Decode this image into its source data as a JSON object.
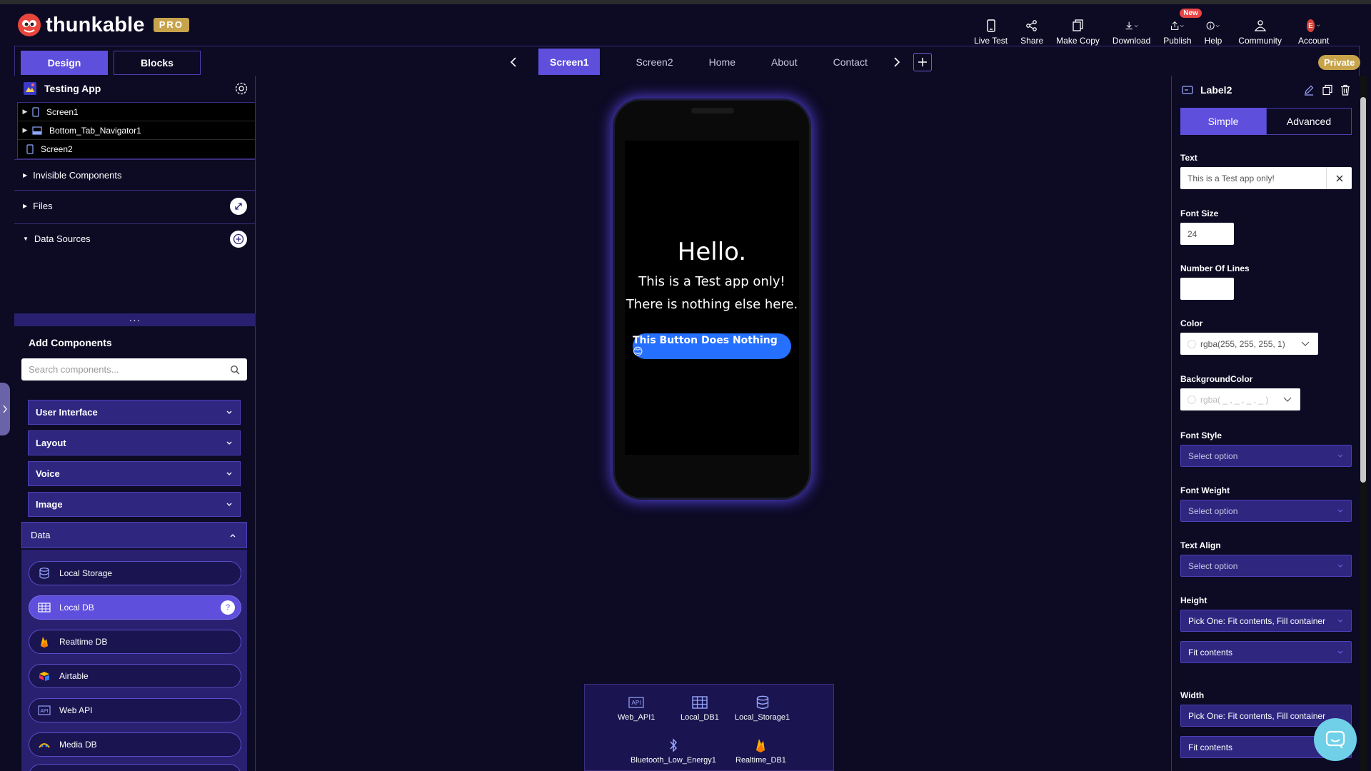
{
  "brand": {
    "name": "thunkable",
    "badge": "PRO"
  },
  "topnav": [
    {
      "label": "Live Test",
      "icon": "phone-icon"
    },
    {
      "label": "Share",
      "icon": "share-icon"
    },
    {
      "label": "Make Copy",
      "icon": "copy-icon"
    },
    {
      "label": "Download",
      "icon": "download-icon"
    },
    {
      "label": "Publish",
      "icon": "publish-icon",
      "badge": "New"
    },
    {
      "label": "Help",
      "icon": "info-icon"
    },
    {
      "label": "Community",
      "icon": "community-icon"
    },
    {
      "label": "Account",
      "icon": "avatar",
      "avatar_letter": "E"
    }
  ],
  "editor_tabs": {
    "design": "Design",
    "blocks": "Blocks"
  },
  "screen_tabs": [
    "Screen1",
    "Screen2",
    "Home",
    "About",
    "Contact"
  ],
  "active_screen": "Screen1",
  "visibility_badge": "Private",
  "left_panel": {
    "app_name": "Testing App",
    "tree": [
      {
        "label": "Screen1",
        "expandable": true
      },
      {
        "label": "Bottom_Tab_Navigator1",
        "expandable": true
      },
      {
        "label": "Screen2",
        "expandable": false
      }
    ],
    "sections": {
      "invisible": "Invisible Components",
      "files": "Files",
      "data_sources": "Data Sources"
    },
    "add_components": "Add Components",
    "search_placeholder": "Search components...",
    "categories": [
      "User Interface",
      "Layout",
      "Voice",
      "Image"
    ],
    "data_category": "Data",
    "data_items": [
      "Local Storage",
      "Local DB",
      "Realtime DB",
      "Airtable",
      "Web API",
      "Media DB"
    ]
  },
  "phone": {
    "heading": "Hello.",
    "line1": "This is a Test app only!",
    "line2": "There is nothing else here.",
    "button": "This Button Does Nothing 😊"
  },
  "invisible_components": [
    "Web_API1",
    "Local_DB1",
    "Local_Storage1",
    "Bluetooth_Low_Energy1",
    "Realtime_DB1"
  ],
  "properties": {
    "component": "Label2",
    "tabs": {
      "simple": "Simple",
      "advanced": "Advanced"
    },
    "text_label": "Text",
    "text_value": "This is a Test app only!",
    "font_size_label": "Font Size",
    "font_size_value": "24",
    "lines_label": "Number Of Lines",
    "lines_value": "",
    "color_label": "Color",
    "color_value": "rgba(255, 255, 255, 1)",
    "bg_label": "BackgroundColor",
    "bg_value": "rgba( _ , _ , _ , _ )",
    "font_style_label": "Font Style",
    "font_weight_label": "Font Weight",
    "text_align_label": "Text Align",
    "select_option": "Select option",
    "height_label": "Height",
    "height_pick": "Pick One: Fit contents, Fill container",
    "height_value": "Fit contents",
    "width_label": "Width",
    "width_pick": "Pick One: Fit contents, Fill container",
    "width_value": "Fit contents"
  },
  "colors": {
    "accent": "#5e4fdc",
    "background": "#0d0a24",
    "badge_gold": "#c7a34b",
    "button_blue": "#2570ff"
  }
}
